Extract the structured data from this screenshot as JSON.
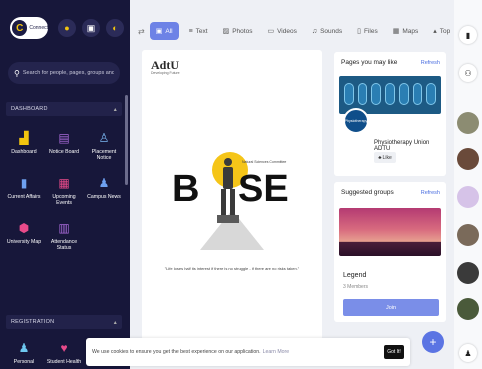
{
  "brand": {
    "logo_text": "Connect",
    "logo_mark": "C"
  },
  "search": {
    "placeholder": "Search for people, pages, groups and #"
  },
  "sections": {
    "dashboard": "DASHBOARD",
    "registration": "REGISTRATION"
  },
  "dashboard_items": [
    {
      "label": "Dashboard",
      "icon": "dashboard-icon",
      "color": "#f1c40f"
    },
    {
      "label": "Notice Board",
      "icon": "notice-board-icon",
      "color": "#a86ad8"
    },
    {
      "label": "Placement Notice",
      "icon": "placement-icon",
      "color": "#7ab6f0"
    },
    {
      "label": "Current Affairs",
      "icon": "current-affairs-icon",
      "color": "#6ea0f0"
    },
    {
      "label": "Upcoming Events",
      "icon": "calendar-icon",
      "color": "#e84a8a"
    },
    {
      "label": "Campus News",
      "icon": "campus-news-icon",
      "color": "#6ea0f0"
    },
    {
      "label": "University Map",
      "icon": "map-pin-icon",
      "color": "#e84a8a"
    },
    {
      "label": "Attendance Status",
      "icon": "attendance-icon",
      "color": "#a86ad8"
    }
  ],
  "registration_items": [
    {
      "label": "Personal",
      "icon": "person-icon",
      "color": "#6ec8f0"
    },
    {
      "label": "Student Health",
      "icon": "health-icon",
      "color": "#e84a8a"
    }
  ],
  "filters": [
    {
      "label": "All",
      "icon": "all-icon",
      "active": true
    },
    {
      "label": "Text",
      "icon": "text-icon",
      "active": false
    },
    {
      "label": "Photos",
      "icon": "photos-icon",
      "active": false
    },
    {
      "label": "Videos",
      "icon": "videos-icon",
      "active": false
    },
    {
      "label": "Sounds",
      "icon": "sounds-icon",
      "active": false
    },
    {
      "label": "Files",
      "icon": "files-icon",
      "active": false
    },
    {
      "label": "Maps",
      "icon": "maps-icon",
      "active": false
    },
    {
      "label": "Top",
      "icon": "caret-up-icon",
      "active": false
    }
  ],
  "post": {
    "brand": "AdtU",
    "brand_sub": "Developing Future",
    "title_left": "B",
    "title_right": "SE",
    "tagline": "Natural Sciences Committee",
    "quote": "\"Life loses half its interest if there is no struggle - if there are no risks taken.\""
  },
  "pages_card": {
    "title": "Pages you may like",
    "refresh": "Refresh",
    "page_name": "Physiotherapy Union ADTU",
    "logo_text": "Physiotherapy",
    "like": "Like"
  },
  "groups_card": {
    "title": "Suggested groups",
    "refresh": "Refresh",
    "group_name": "Legend",
    "members": "3 Members",
    "join": "Join"
  },
  "cookie": {
    "text": "We use cookies to ensure you get the best experience on our application.",
    "link": "Learn More",
    "button": "Got It!"
  },
  "fab": {
    "label": "+"
  },
  "colors": {
    "sidebar_bg": "#17173a",
    "accent": "#6d82e6",
    "join": "#7a8ee8"
  }
}
